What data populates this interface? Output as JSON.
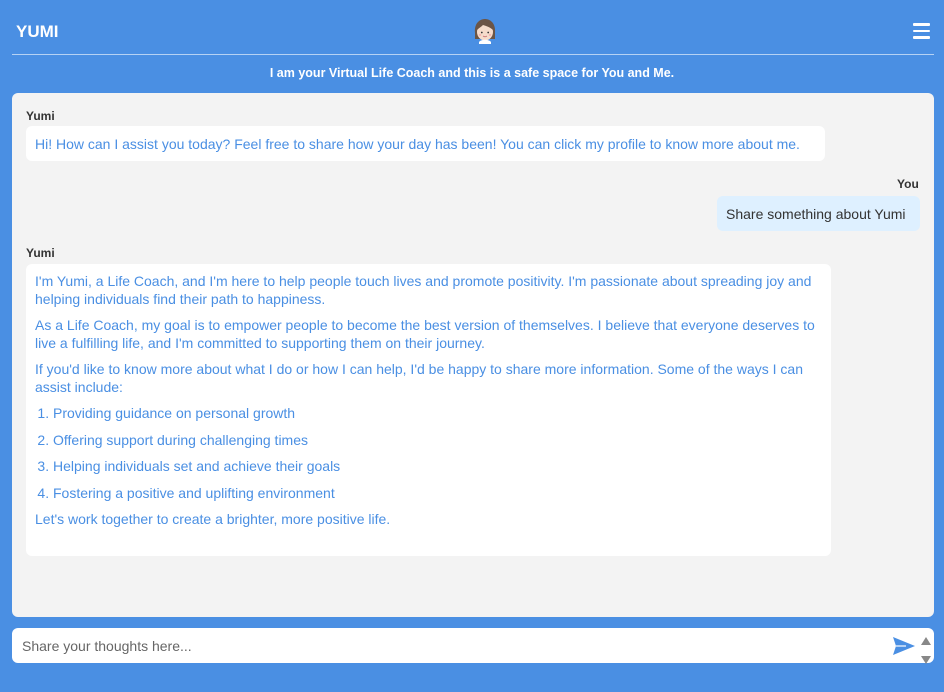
{
  "header": {
    "brand": "YUMI",
    "avatar_icon": "woman-avatar-icon",
    "menu_icon": "hamburger-menu-icon"
  },
  "tagline": "I am your Virtual Life Coach and this is a safe space for You and Me.",
  "messages": [
    {
      "sender": "Yumi",
      "text": "Hi! How can I assist you today? Feel free to share how your day has been! You can click my profile to know more about me."
    },
    {
      "sender": "You",
      "text": "Share something about Yumi"
    },
    {
      "sender": "Yumi",
      "paragraphs": [
        "I'm Yumi, a Life Coach, and I'm here to help people touch lives and promote positivity. I'm passionate about spreading joy and helping individuals find their path to happiness.",
        "As a Life Coach, my goal is to empower people to become the best version of themselves. I believe that everyone deserves to live a fulfilling life, and I'm committed to supporting them on their journey.",
        "If you'd like to know more about what I do or how I can help, I'd be happy to share more information. Some of the ways I can assist include:"
      ],
      "list": [
        "Providing guidance on personal growth",
        "Offering support during challenging times",
        "Helping individuals set and achieve their goals",
        "Fostering a positive and uplifting environment"
      ],
      "closing": "Let's work together to create a brighter, more positive life."
    }
  ],
  "composer": {
    "placeholder": "Share your thoughts here...",
    "value": "",
    "send_icon": "send-arrow-icon"
  },
  "colors": {
    "background": "#4a8fe3",
    "chat_panel": "#f3f3f3",
    "bot_text": "#4a8fe3",
    "user_bubble": "#def0ff"
  }
}
